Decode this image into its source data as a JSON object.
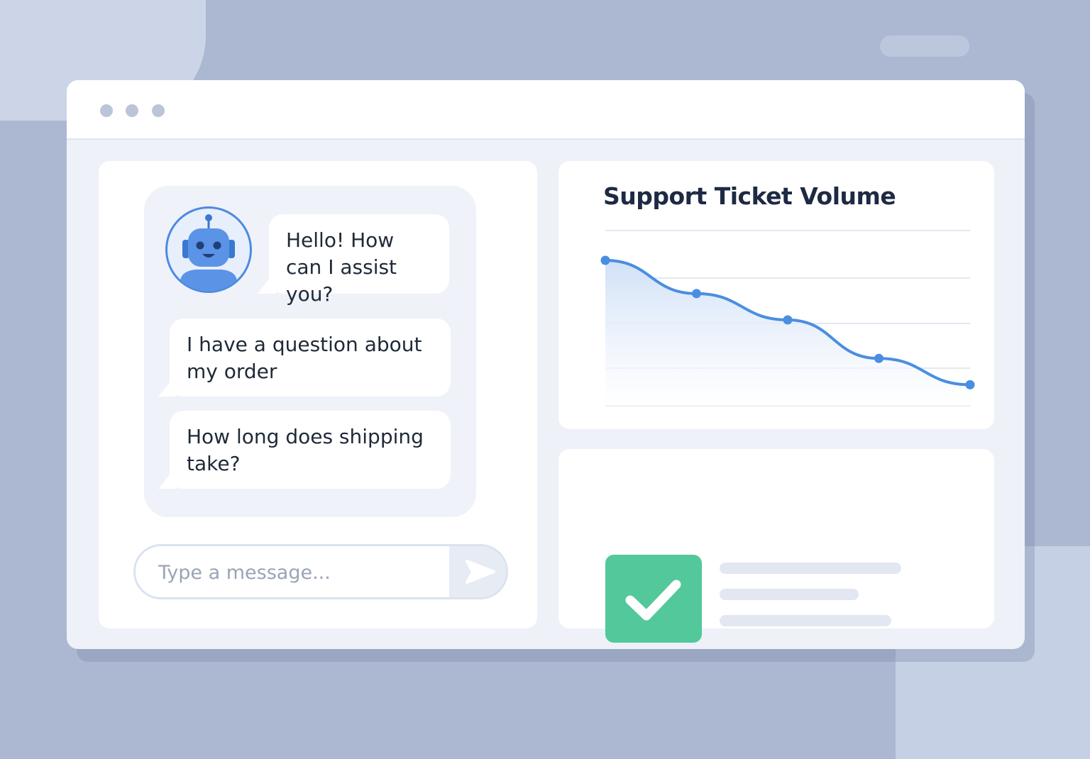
{
  "chat": {
    "messages": [
      {
        "sender": "bot",
        "text": "Hello! How can I assist you?"
      },
      {
        "sender": "user",
        "text": "I have a question about my order"
      },
      {
        "sender": "user",
        "text": "How long does shipping take?"
      }
    ],
    "input": {
      "placeholder": "Type a message...",
      "value": ""
    },
    "send_icon": "send-arrow-icon",
    "avatar_icon": "robot-icon"
  },
  "chart": {
    "title": "Support Ticket Volume"
  },
  "chart_data": {
    "type": "area",
    "title": "Support Ticket Volume",
    "xlabel": "",
    "ylabel": "",
    "x": [
      1,
      2,
      3,
      4,
      5
    ],
    "values": [
      83,
      64,
      49,
      27,
      12
    ],
    "ylim": [
      0,
      100
    ],
    "grid": true,
    "color": "#4a8ee0",
    "fill_color": "#d6e4f8"
  },
  "status": {
    "icon": "check-icon",
    "color": "#52c89b"
  },
  "window": {
    "controls": [
      "window-dot",
      "window-dot",
      "window-dot"
    ]
  }
}
